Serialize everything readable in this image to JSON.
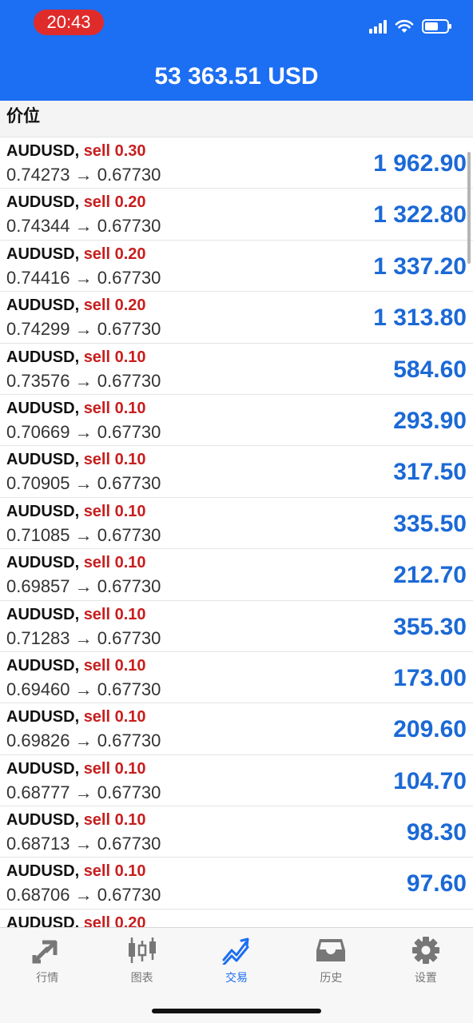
{
  "status_bar": {
    "time": "20:43"
  },
  "header": {
    "balance": "53 363.51 USD"
  },
  "section": {
    "title": "价位"
  },
  "positions": [
    {
      "symbol": "AUDUSD",
      "sep": ", ",
      "side": "sell 0.30",
      "open": "0.74273",
      "arrow": "→",
      "current": "0.67730",
      "profit": "1 962.90"
    },
    {
      "symbol": "AUDUSD",
      "sep": ", ",
      "side": "sell 0.20",
      "open": "0.74344",
      "arrow": "→",
      "current": "0.67730",
      "profit": "1 322.80"
    },
    {
      "symbol": "AUDUSD",
      "sep": ", ",
      "side": "sell 0.20",
      "open": "0.74416",
      "arrow": "→",
      "current": "0.67730",
      "profit": "1 337.20"
    },
    {
      "symbol": "AUDUSD",
      "sep": ", ",
      "side": "sell 0.20",
      "open": "0.74299",
      "arrow": "→",
      "current": "0.67730",
      "profit": "1 313.80"
    },
    {
      "symbol": "AUDUSD",
      "sep": ", ",
      "side": "sell 0.10",
      "open": "0.73576",
      "arrow": "→",
      "current": "0.67730",
      "profit": "584.60"
    },
    {
      "symbol": "AUDUSD",
      "sep": ", ",
      "side": "sell 0.10",
      "open": "0.70669",
      "arrow": "→",
      "current": "0.67730",
      "profit": "293.90"
    },
    {
      "symbol": "AUDUSD",
      "sep": ", ",
      "side": "sell 0.10",
      "open": "0.70905",
      "arrow": "→",
      "current": "0.67730",
      "profit": "317.50"
    },
    {
      "symbol": "AUDUSD",
      "sep": ", ",
      "side": "sell 0.10",
      "open": "0.71085",
      "arrow": "→",
      "current": "0.67730",
      "profit": "335.50"
    },
    {
      "symbol": "AUDUSD",
      "sep": ", ",
      "side": "sell 0.10",
      "open": "0.69857",
      "arrow": "→",
      "current": "0.67730",
      "profit": "212.70"
    },
    {
      "symbol": "AUDUSD",
      "sep": ", ",
      "side": "sell 0.10",
      "open": "0.71283",
      "arrow": "→",
      "current": "0.67730",
      "profit": "355.30"
    },
    {
      "symbol": "AUDUSD",
      "sep": ", ",
      "side": "sell 0.10",
      "open": "0.69460",
      "arrow": "→",
      "current": "0.67730",
      "profit": "173.00"
    },
    {
      "symbol": "AUDUSD",
      "sep": ", ",
      "side": "sell 0.10",
      "open": "0.69826",
      "arrow": "→",
      "current": "0.67730",
      "profit": "209.60"
    },
    {
      "symbol": "AUDUSD",
      "sep": ", ",
      "side": "sell 0.10",
      "open": "0.68777",
      "arrow": "→",
      "current": "0.67730",
      "profit": "104.70"
    },
    {
      "symbol": "AUDUSD",
      "sep": ", ",
      "side": "sell 0.10",
      "open": "0.68713",
      "arrow": "→",
      "current": "0.67730",
      "profit": "98.30"
    },
    {
      "symbol": "AUDUSD",
      "sep": ", ",
      "side": "sell 0.10",
      "open": "0.68706",
      "arrow": "→",
      "current": "0.67730",
      "profit": "97.60"
    },
    {
      "symbol": "AUDUSD",
      "sep": ". ",
      "side": "sell 0.20",
      "open": "",
      "arrow": "",
      "current": "",
      "profit": ""
    }
  ],
  "tabs": [
    {
      "label": "行情",
      "icon": "quotes-arrows-icon",
      "active": false
    },
    {
      "label": "图表",
      "icon": "candlestick-chart-icon",
      "active": false
    },
    {
      "label": "交易",
      "icon": "trade-trend-icon",
      "active": true
    },
    {
      "label": "历史",
      "icon": "history-inbox-icon",
      "active": false
    },
    {
      "label": "设置",
      "icon": "gear-icon",
      "active": false
    }
  ],
  "colors": {
    "accent": "#1c6ef2",
    "sell": "#c81e1e",
    "profit": "#1b69d6",
    "time_pill": "#e02b2b"
  }
}
